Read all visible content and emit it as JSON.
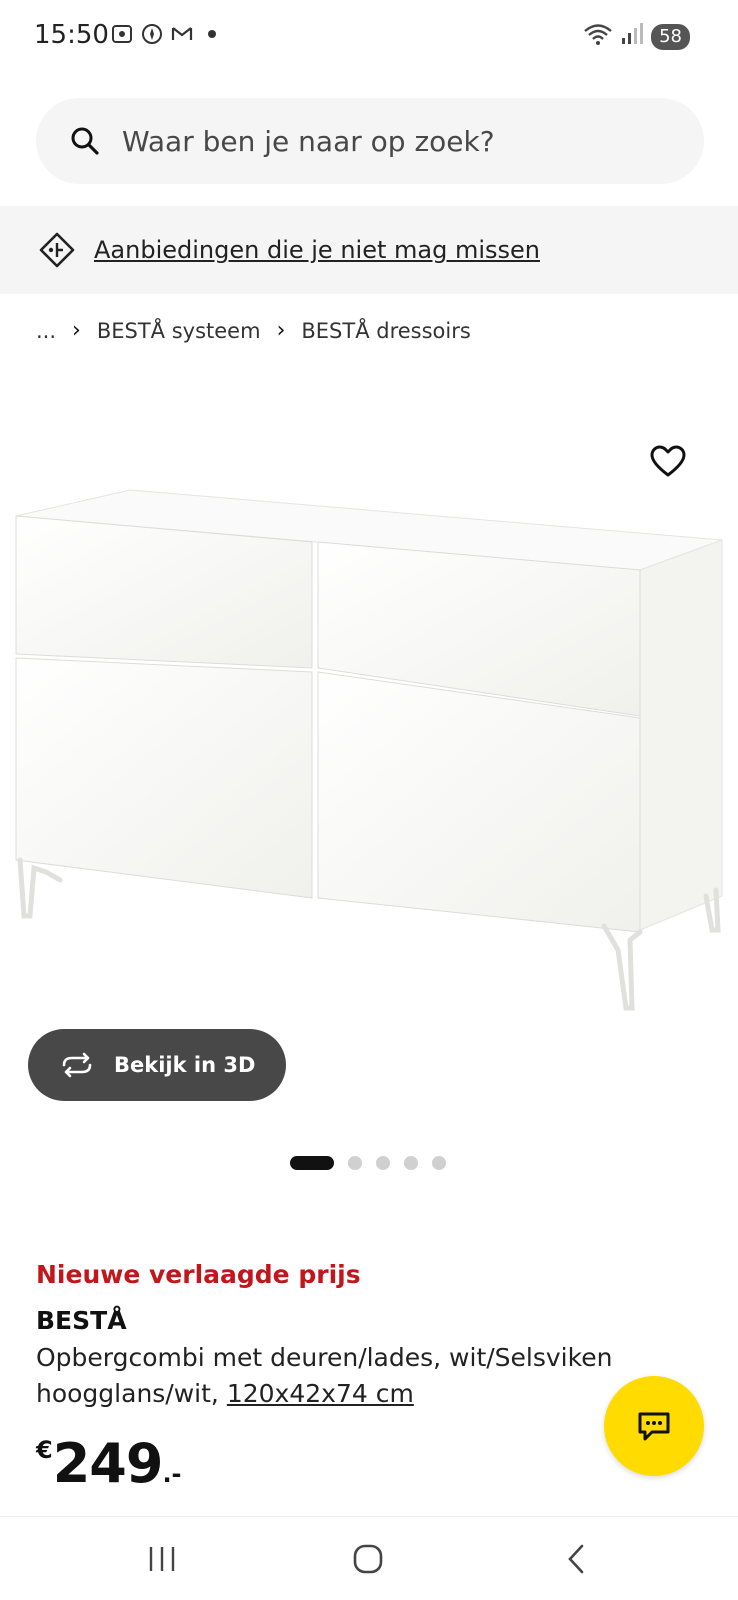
{
  "status_bar": {
    "time": "15:50",
    "battery": "58"
  },
  "search": {
    "placeholder": "Waar ben je naar op zoek?"
  },
  "promo": {
    "text": "Aanbiedingen die je niet mag missen"
  },
  "breadcrumb": {
    "ellipsis": "...",
    "items": [
      "BESTÅ systeem",
      "BESTÅ dressoirs"
    ]
  },
  "product": {
    "view_3d_label": "Bekijk in 3D",
    "carousel": {
      "total": 5,
      "active_index": 0
    },
    "price_note": "Nieuwe verlaagde prijs",
    "name": "BESTÅ",
    "description": "Opbergcombi met deuren/lades, wit/Selsviken hoogglans/wit,",
    "size": "120x42x74 cm",
    "price_currency": "€",
    "price_amount": "249",
    "price_decimals": ".-"
  },
  "icons": {
    "search": "search-icon",
    "promo": "tag-icon",
    "favorite": "heart-icon",
    "view3d": "rotate-icon",
    "chat": "chat-icon"
  },
  "colors": {
    "accent_red": "#c0161c",
    "chat_yellow": "#ffdb00",
    "button_dark": "#484848"
  }
}
